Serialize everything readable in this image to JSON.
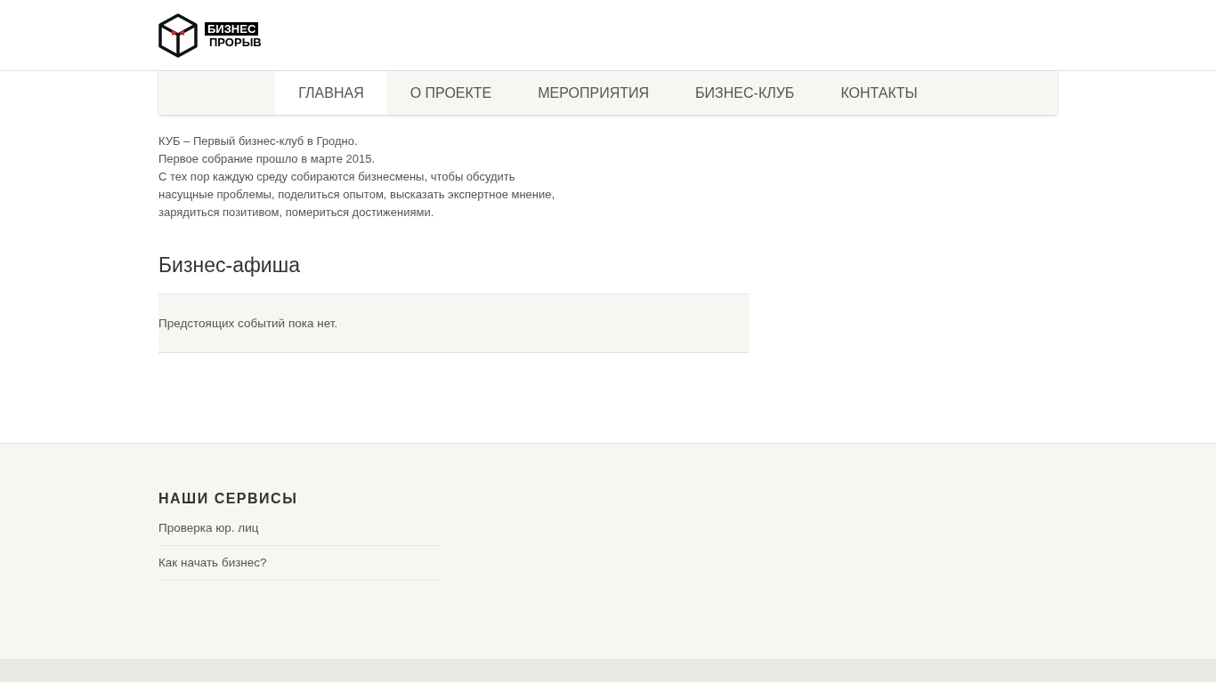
{
  "logo": {
    "line_1": "БИЗНЕС",
    "line_2": "ПРОРЫВ"
  },
  "nav": [
    {
      "label": "ГЛАВНАЯ",
      "selected": true
    },
    {
      "label": "О ПРОЕКТЕ",
      "selected": false
    },
    {
      "label": "МЕРОПРИЯТИЯ",
      "selected": false
    },
    {
      "label": "БИЗНЕС-КЛУБ",
      "selected": false
    },
    {
      "label": "КОНТАКТЫ",
      "selected": false
    }
  ],
  "intro": [
    "КУБ – Первый бизнес-клуб в Гродно.",
    "Первое собрание прошло в марте 2015.",
    "С тех пор каждую среду собираются бизнесмены, чтобы обсудить",
    "насущные проблемы, поделиться опытом, высказать экспертное мнение,",
    "зарядиться позитивом, помериться достижениями."
  ],
  "events": {
    "title": "Бизнес-афиша",
    "message": "Предстоящих событий пока нет."
  },
  "footer": {
    "title": "НАШИ СЕРВИСЫ",
    "links": [
      "Проверка юр. лиц",
      "Как начать бизнес?"
    ]
  }
}
